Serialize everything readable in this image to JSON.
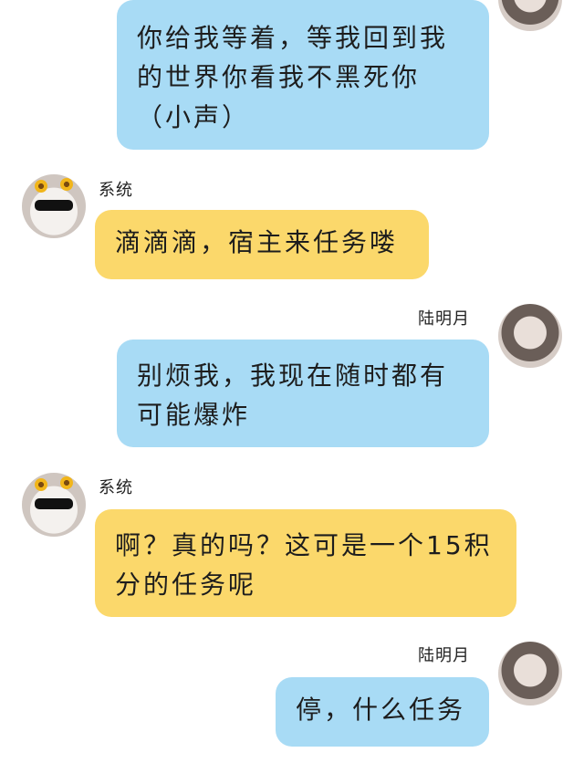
{
  "messages": [
    {
      "side": "right",
      "sender": "",
      "text": "你给我等着，等我回到我的世界你看我不黑死你（小声）"
    },
    {
      "side": "left",
      "sender": "系统",
      "text": "滴滴滴，宿主来任务喽"
    },
    {
      "side": "right",
      "sender": "陆明月",
      "text": "别烦我，我现在随时都有可能爆炸"
    },
    {
      "side": "left",
      "sender": "系统",
      "text": "啊？真的吗？这可是一个15积分的任务呢"
    },
    {
      "side": "right",
      "sender": "陆明月",
      "text": "停，什么任务"
    }
  ],
  "colors": {
    "user_bubble": "#a8dbf5",
    "system_bubble": "#fbd86b"
  }
}
